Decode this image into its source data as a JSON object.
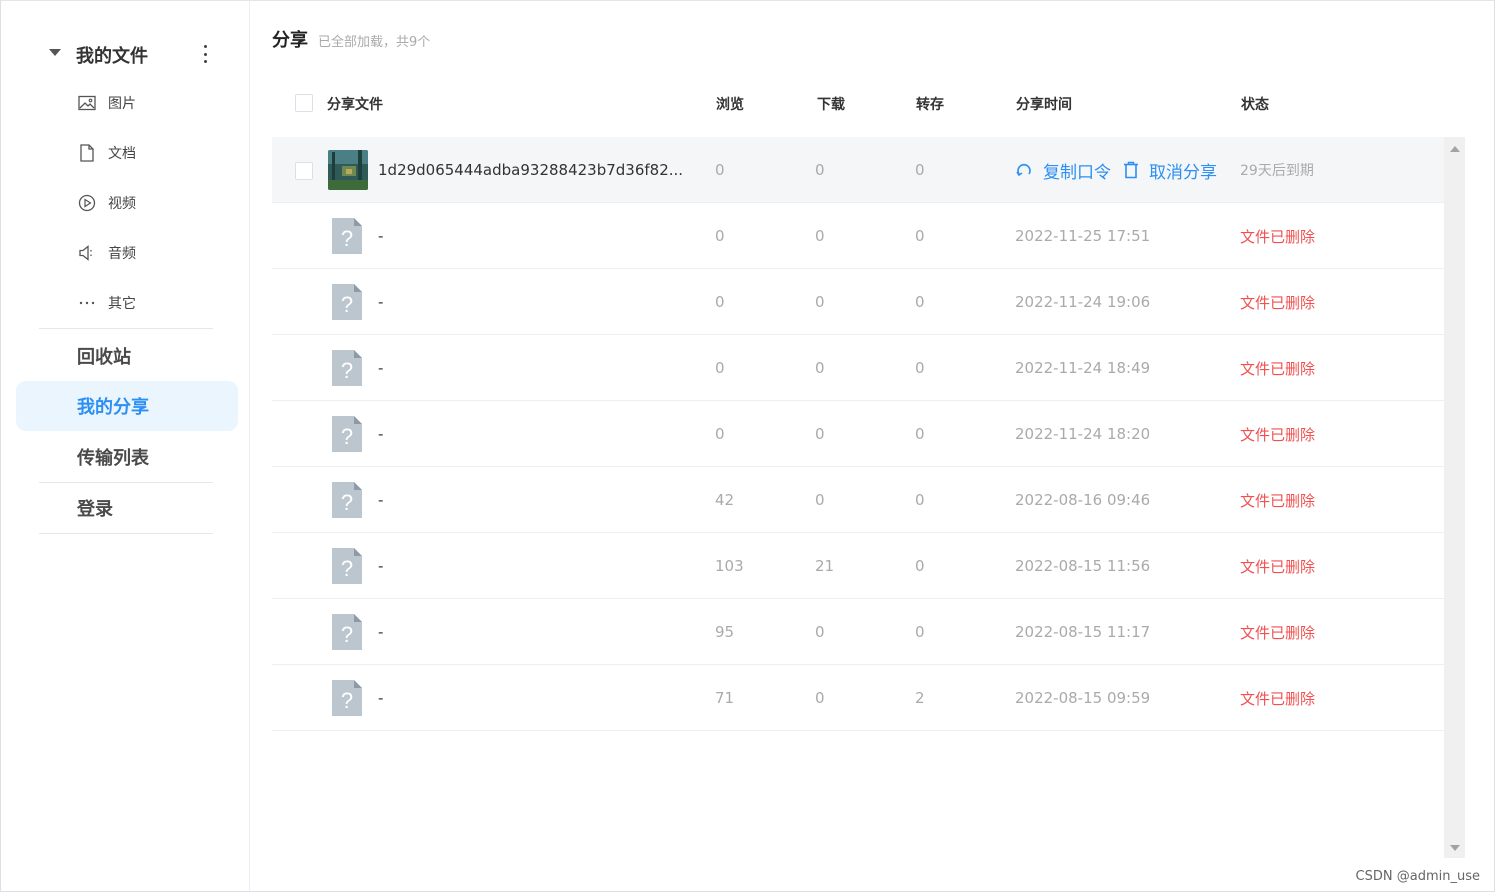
{
  "sidebar": {
    "title": "我的文件",
    "sub_items": [
      {
        "label": "图片",
        "icon": "image-icon"
      },
      {
        "label": "文档",
        "icon": "document-icon"
      },
      {
        "label": "视频",
        "icon": "video-icon"
      },
      {
        "label": "音频",
        "icon": "audio-icon"
      },
      {
        "label": "其它",
        "icon": "more-icon"
      }
    ],
    "main_items": [
      {
        "label": "回收站"
      },
      {
        "label": "我的分享"
      },
      {
        "label": "传输列表"
      },
      {
        "label": "登录"
      }
    ],
    "active_item": "我的分享"
  },
  "header": {
    "title": "分享",
    "subtitle": "已全部加载，共9个"
  },
  "table": {
    "columns": [
      "分享文件",
      "浏览",
      "下载",
      "转存",
      "分享时间",
      "状态"
    ],
    "rows": [
      {
        "file": "1d29d065444adba93288423b7d36f82...",
        "views": "0",
        "downloads": "0",
        "saves": "0",
        "copy_label": "复制口令",
        "cancel_label": "取消分享",
        "status": "29天后到期"
      },
      {
        "file": "-",
        "views": "0",
        "downloads": "0",
        "saves": "0",
        "time": "2022-11-25 17:51",
        "status": "文件已删除"
      },
      {
        "file": "-",
        "views": "0",
        "downloads": "0",
        "saves": "0",
        "time": "2022-11-24 19:06",
        "status": "文件已删除"
      },
      {
        "file": "-",
        "views": "0",
        "downloads": "0",
        "saves": "0",
        "time": "2022-11-24 18:49",
        "status": "文件已删除"
      },
      {
        "file": "-",
        "views": "0",
        "downloads": "0",
        "saves": "0",
        "time": "2022-11-24 18:20",
        "status": "文件已删除"
      },
      {
        "file": "-",
        "views": "42",
        "downloads": "0",
        "saves": "0",
        "time": "2022-08-16 09:46",
        "status": "文件已删除"
      },
      {
        "file": "-",
        "views": "103",
        "downloads": "21",
        "saves": "0",
        "time": "2022-08-15 11:56",
        "status": "文件已删除"
      },
      {
        "file": "-",
        "views": "95",
        "downloads": "0",
        "saves": "0",
        "time": "2022-08-15 11:17",
        "status": "文件已删除"
      },
      {
        "file": "-",
        "views": "71",
        "downloads": "0",
        "saves": "2",
        "time": "2022-08-15 09:59",
        "status": "文件已删除"
      }
    ]
  },
  "watermark": "CSDN @admin_use",
  "colors": {
    "accent": "#2b8ff3",
    "danger": "#f25050",
    "muted": "#aaaaaa",
    "active_bg": "#ebf5fe"
  }
}
